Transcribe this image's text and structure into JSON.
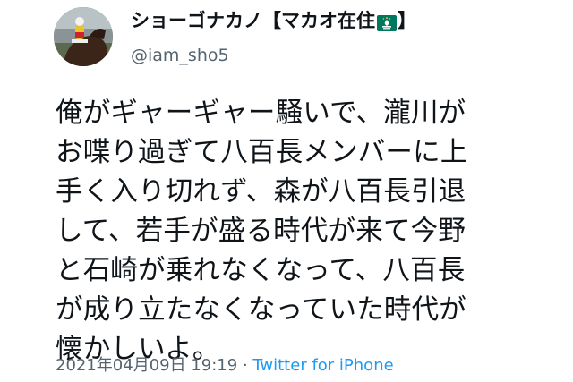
{
  "tweet": {
    "display_name_prefix": "ショーゴナカノ【マカオ在住",
    "display_name_suffix": "】",
    "flag_icon": "macao-flag-icon",
    "handle": "@iam_sho5",
    "text_lines": [
      "俺がギャーギャー騒いで、瀧川が",
      "お喋り過ぎて八百長メンバーに上",
      "手く入り切れず、森が八百長引退",
      "して、若手が盛る時代が来て今野",
      "と石崎が乗れなくなって、八百長",
      "が成り立たなくなっていた時代が",
      "懐かしいよ。"
    ],
    "timestamp": "2021年04月09日 19:19",
    "separator": " · ",
    "source": "Twitter for iPhone"
  },
  "colors": {
    "text": "#0f1419",
    "secondary": "#536471",
    "link": "#1d9bf0",
    "flag_green": "#00785e"
  }
}
